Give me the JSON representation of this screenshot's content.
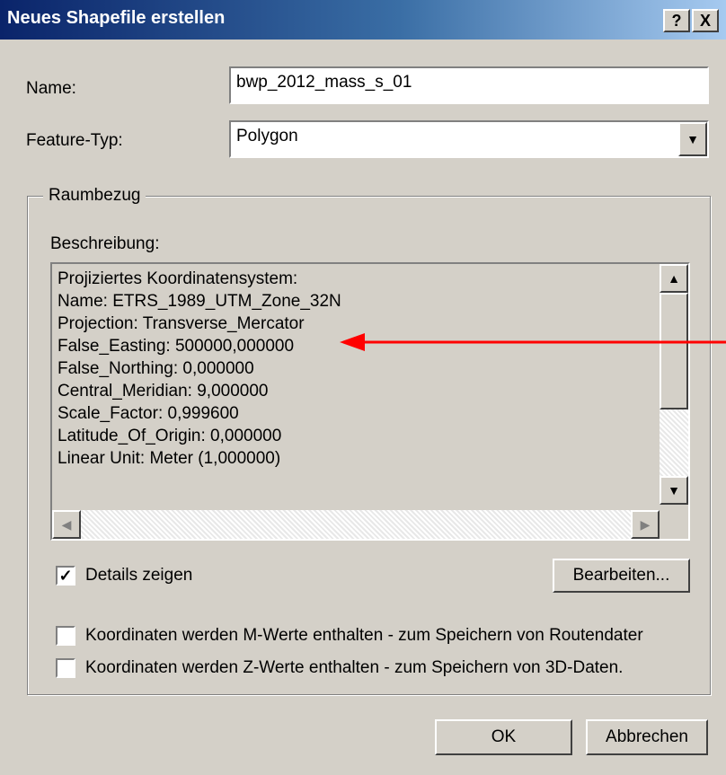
{
  "window": {
    "title": "Neues Shapefile erstellen",
    "help_button": "?",
    "close_button": "X"
  },
  "form": {
    "name_label": "Name:",
    "name_value": "bwp_2012_mass_s_01",
    "feature_type_label": "Feature-Typ:",
    "feature_type_value": "Polygon"
  },
  "spatial_reference": {
    "group_label": "Raumbezug",
    "description_label": "Beschreibung:",
    "description_lines": [
      "Projiziertes Koordinatensystem:",
      "Name: ETRS_1989_UTM_Zone_32N",
      "Projection: Transverse_Mercator",
      "False_Easting: 500000,000000",
      "False_Northing: 0,000000",
      "Central_Meridian: 9,000000",
      "Scale_Factor: 0,999600",
      "Latitude_Of_Origin: 0,000000",
      "Linear Unit: Meter (1,000000)"
    ],
    "show_details_label": "Details zeigen",
    "show_details_checked": true,
    "edit_button": "Bearbeiten..."
  },
  "options": {
    "m_values_label": "Koordinaten werden M-Werte enthalten - zum Speichern von Routendater",
    "m_values_checked": false,
    "z_values_label": "Koordinaten werden Z-Werte enthalten - zum Speichern von 3D-Daten.",
    "z_values_checked": false
  },
  "buttons": {
    "ok": "OK",
    "cancel": "Abbrechen"
  },
  "icons": {
    "dropdown": "chevron-down-icon",
    "scroll_up": "arrow-up-icon",
    "scroll_down": "arrow-down-icon",
    "scroll_left": "arrow-left-icon",
    "scroll_right": "arrow-right-icon",
    "annotation": "red-arrow-icon"
  },
  "colors": {
    "title_bar": "#0a246a",
    "face": "#d4d0c8",
    "annotation_arrow": "#ff0000"
  }
}
